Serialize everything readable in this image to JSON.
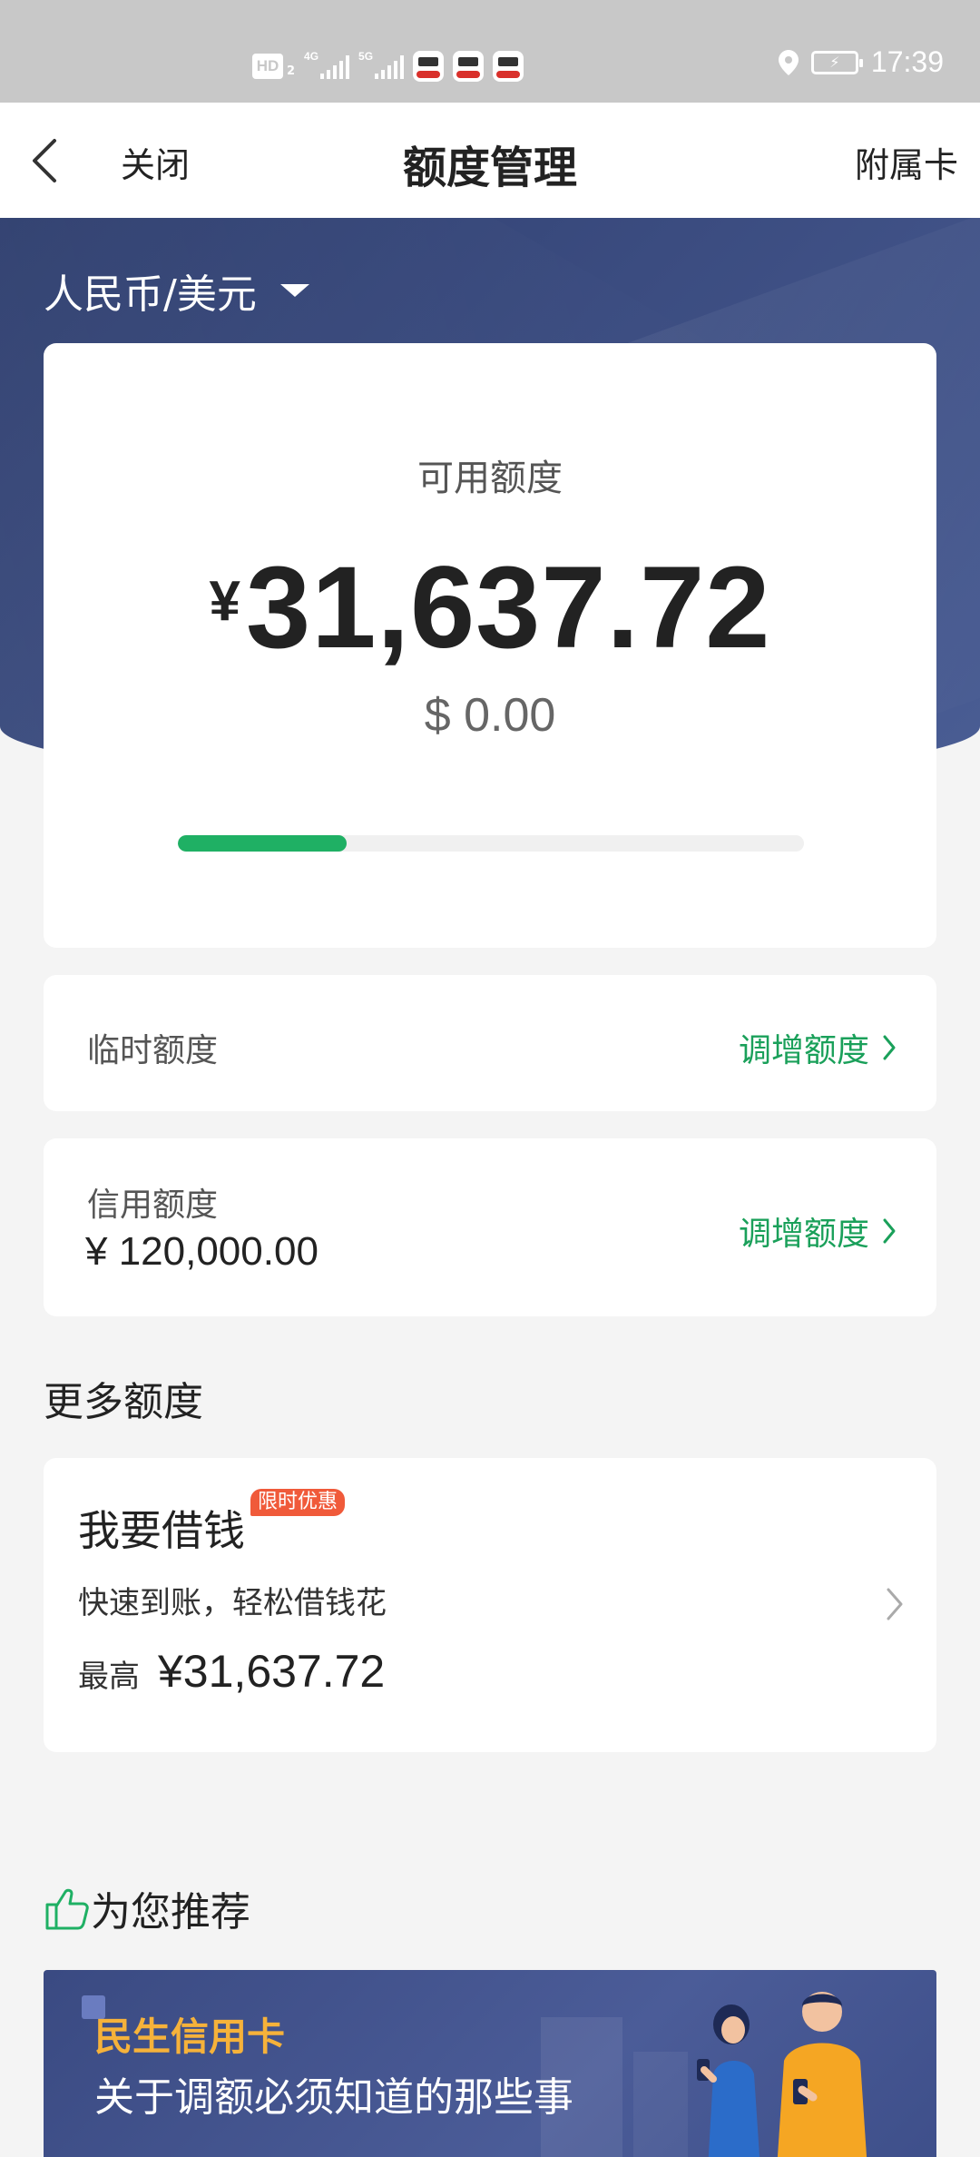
{
  "status_bar": {
    "hd_label": "HD",
    "hd_sub": "2",
    "network_1": "4G",
    "network_2": "5G",
    "time": "17:39"
  },
  "nav": {
    "close_label": "关闭",
    "title": "额度管理",
    "sub_card_label": "附属卡"
  },
  "currency": {
    "selected": "人民币/美元"
  },
  "available": {
    "label": "可用额度",
    "cny_symbol": "¥",
    "cny_amount": "31,637.72",
    "usd_amount": "$ 0.00",
    "usage_fraction": 0.27
  },
  "temporary_limit": {
    "label": "临时额度",
    "action": "调增额度"
  },
  "credit_limit": {
    "label": "信用额度",
    "value": "¥ 120,000.00",
    "action": "调增额度"
  },
  "more_section": {
    "title": "更多额度"
  },
  "loan": {
    "title": "我要借钱",
    "badge": "限时优惠",
    "desc": "快速到账，轻松借钱花",
    "max_prefix": "最高",
    "max_amount": "¥31,637.72"
  },
  "recommend": {
    "title": "为您推荐",
    "banner_brand": "民生信用卡",
    "banner_text": "关于调额必须知道的那些事"
  },
  "colors": {
    "accent_green": "#1fb064",
    "link_green": "#1aa05a",
    "hero_blue": "#3b4c80",
    "badge_orange": "#f05a3a",
    "banner_gold": "#f6b23a"
  }
}
